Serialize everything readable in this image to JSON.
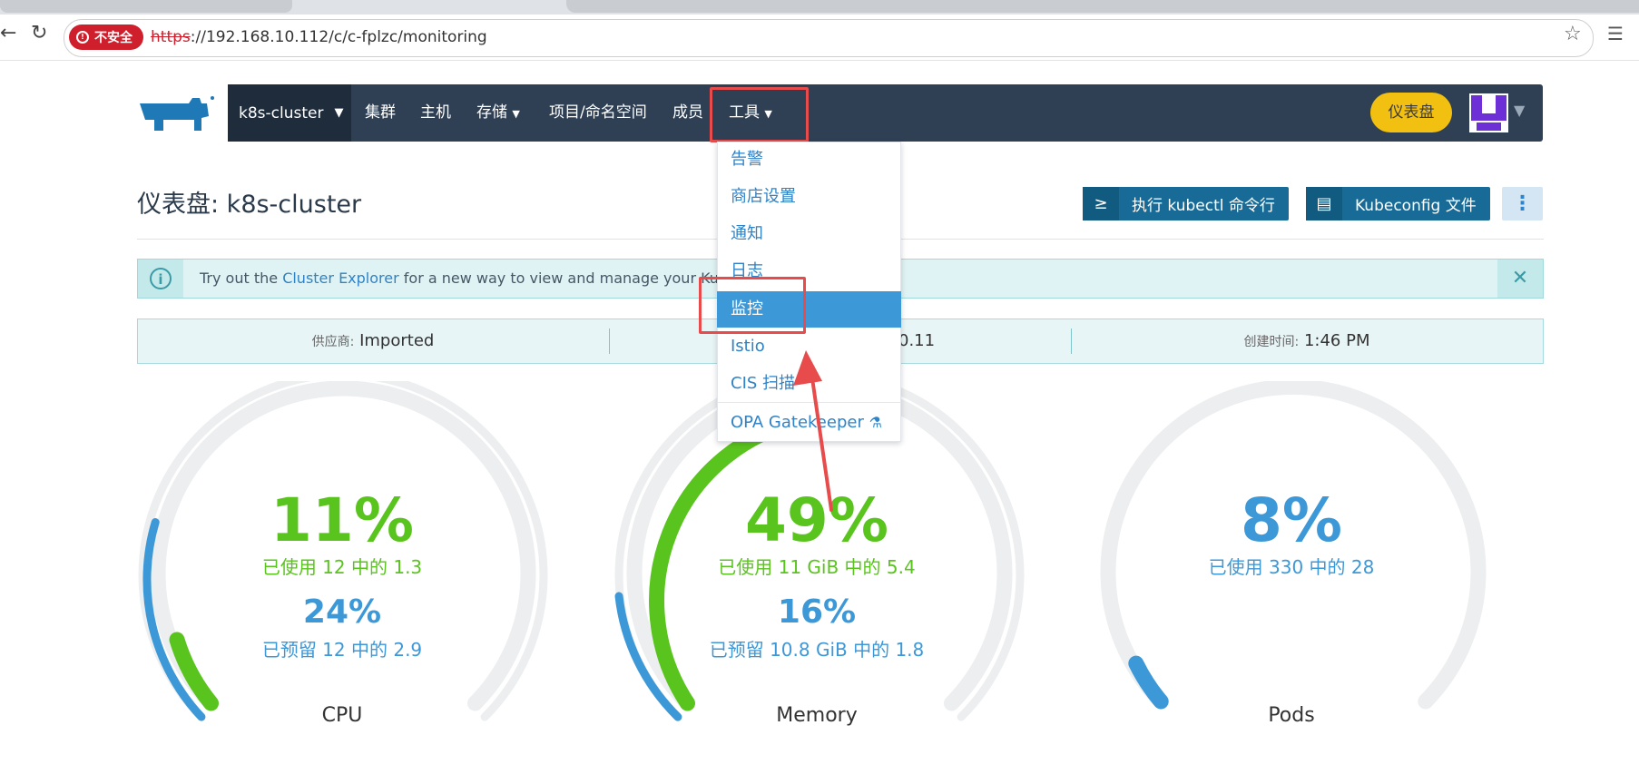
{
  "browser": {
    "security_label": "不安全",
    "url_scheme": "https",
    "url_rest": "://192.168.10.112/c/c-fplzc/monitoring"
  },
  "header": {
    "cluster_name": "k8s-cluster",
    "nav": [
      "集群",
      "主机",
      "存储",
      "项目/命名空间",
      "成员",
      "工具"
    ],
    "dashboard_button": "仪表盘"
  },
  "page": {
    "title": "仪表盘: k8s-cluster",
    "kubectl_button": "执行 kubectl 命令行",
    "kubeconfig_button": "Kubeconfig 文件"
  },
  "banner": {
    "prefix": "Try out the ",
    "link": "Cluster Explorer",
    "suffix": " for a new way to view and manage your Kub"
  },
  "info": {
    "provider_label": "供应商:",
    "provider_value": "Imported",
    "middle_value": "0.11",
    "created_label": "创建时间:",
    "created_value": "1:46 PM"
  },
  "tools_menu": {
    "items": [
      "告警",
      "商店设置",
      "通知",
      "日志",
      "监控",
      "Istio",
      "CIS 扫描",
      "OPA Gatekeeper"
    ],
    "active": "监控"
  },
  "gauges": [
    {
      "name": "CPU",
      "used_pct": "11%",
      "used_text": "已使用 12 中的 1.3",
      "reserved_pct": "24%",
      "reserved_text": "已预留 12 中的 2.9",
      "used_fraction": 0.11,
      "reserved_fraction": 0.24
    },
    {
      "name": "Memory",
      "used_pct": "49%",
      "used_text": "已使用 11 GiB 中的 5.4",
      "reserved_pct": "16%",
      "reserved_text": "已预留 10.8 GiB 中的 1.8",
      "used_fraction": 0.49,
      "reserved_fraction": 0.16
    },
    {
      "name": "Pods",
      "used_pct": "8%",
      "used_text": "已使用 330 中的 28",
      "used_fraction": 0.08
    }
  ],
  "colors": {
    "green": "#5ac41e",
    "blue": "#3d98d8",
    "track": "#eceeef",
    "highlight": "#e84b4b"
  }
}
